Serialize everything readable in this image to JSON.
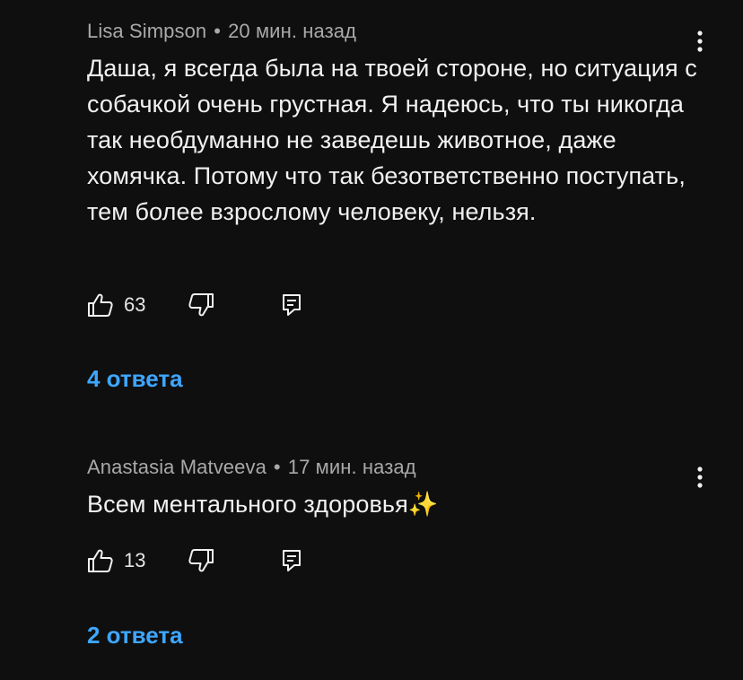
{
  "comments": [
    {
      "author": "Lisa Simpson",
      "separator": "•",
      "time": "20 мин. назад",
      "text": "Даша, я всегда была на твоей стороне, но ситуация с собачкой очень грустная. Я надеюсь, что ты никогда так необдуманно не заведешь животное, даже хомячка. Потому что так безответственно поступать, тем более взрослому человеку, нельзя.",
      "likes": "63",
      "replies": "4 ответа"
    },
    {
      "author": "Anastasia Matveeva",
      "separator": "•",
      "time": "17 мин. назад",
      "text": "Всем ментального здоровья",
      "emoji": "✨",
      "likes": "13",
      "replies": "2 ответа"
    }
  ],
  "icons": {
    "like": "thumbs-up-icon",
    "dislike": "thumbs-down-icon",
    "reply": "reply-comment-icon",
    "menu": "more-vert-icon"
  },
  "colors": {
    "background": "#0f0f0f",
    "text": "#f1f1f1",
    "meta": "#a9a9a9",
    "link": "#3ea6ff"
  }
}
